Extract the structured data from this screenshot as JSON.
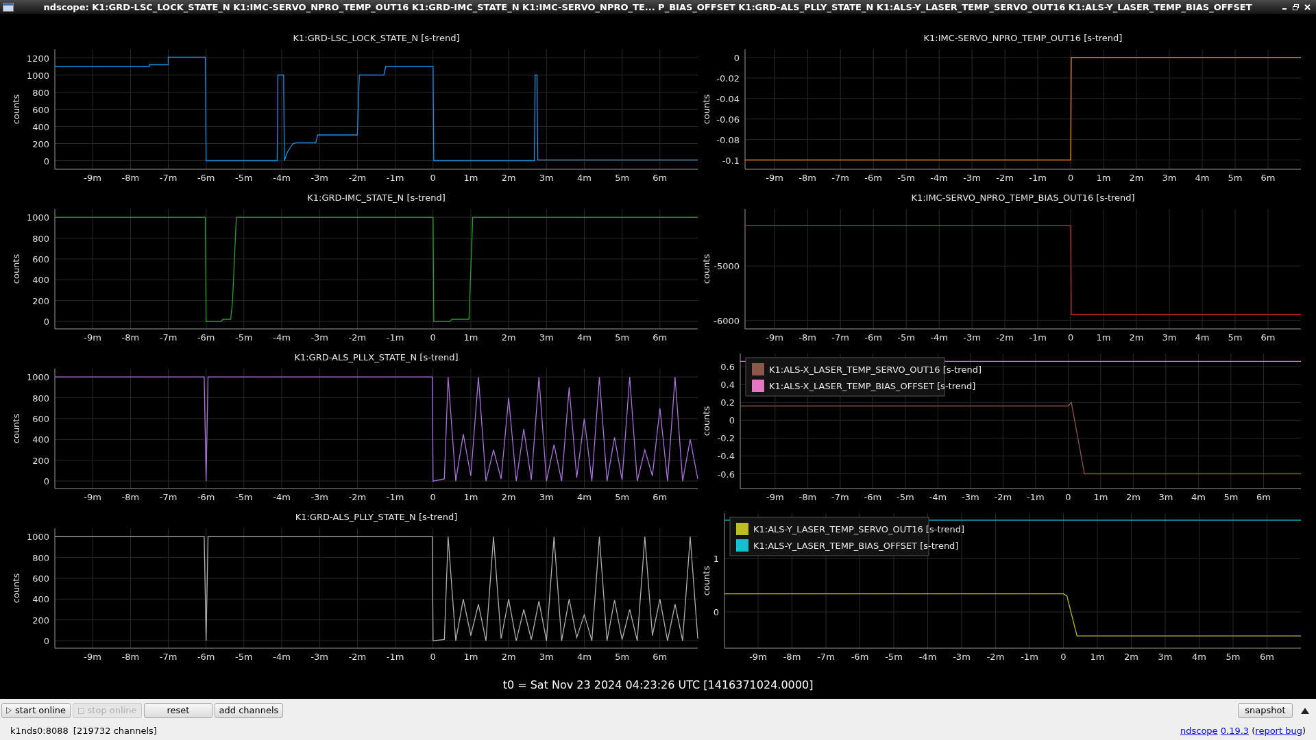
{
  "window": {
    "title": "ndscope: K1:GRD-LSC_LOCK_STATE_N K1:IMC-SERVO_NPRO_TEMP_OUT16 K1:GRD-IMC_STATE_N K1:IMC-SERVO_NPRO_TE... P_BIAS_OFFSET K1:GRD-ALS_PLLY_STATE_N K1:ALS-Y_LASER_TEMP_SERVO_OUT16 K1:ALS-Y_LASER_TEMP_BIAS_OFFSET"
  },
  "charts": [
    {
      "chart_data": {
        "type": "line",
        "grid": true,
        "title": "K1:GRD-LSC_LOCK_STATE_N [s-trend]",
        "ylabel": "counts",
        "xlim": [
          -10,
          7
        ],
        "ylim": [
          -100,
          1300
        ],
        "yticks": [
          0,
          200,
          400,
          600,
          800,
          1000,
          1200
        ],
        "xticks": [
          {
            "value": -9,
            "label": "-9m"
          },
          {
            "value": -8,
            "label": "-8m"
          },
          {
            "value": -7,
            "label": "-7m"
          },
          {
            "value": -6,
            "label": "-6m"
          },
          {
            "value": -5,
            "label": "-5m"
          },
          {
            "value": -4,
            "label": "-4m"
          },
          {
            "value": -3,
            "label": "-3m"
          },
          {
            "value": -2,
            "label": "-2m"
          },
          {
            "value": -1,
            "label": "-1m"
          },
          {
            "value": 0,
            "label": "0"
          },
          {
            "value": 1,
            "label": "1m"
          },
          {
            "value": 2,
            "label": "2m"
          },
          {
            "value": 3,
            "label": "3m"
          },
          {
            "value": 4,
            "label": "4m"
          },
          {
            "value": 5,
            "label": "5m"
          },
          {
            "value": 6,
            "label": "6m"
          }
        ],
        "x": [
          -10,
          -7.5,
          -7.5,
          -7,
          -7,
          -6.02,
          -6,
          -4.12,
          -4.1,
          -3.95,
          -3.93,
          -3.85,
          -3.7,
          -3.6,
          -3.1,
          -3.05,
          -2.0,
          -1.95,
          -1.3,
          -1.25,
          0,
          0.02,
          2.68,
          2.7,
          2.75,
          2.77,
          7
        ],
        "series": [
          {
            "color": "#1f8fe0",
            "values": [
              1100,
              1100,
              1120,
              1120,
              1210,
              1210,
              0,
              0,
              1000,
              1000,
              0,
              100,
              200,
              210,
              210,
              300,
              300,
              1000,
              1000,
              1100,
              1100,
              0,
              0,
              1000,
              1000,
              10,
              10
            ]
          }
        ]
      }
    },
    {
      "chart_data": {
        "type": "line",
        "grid": true,
        "title": "K1:IMC-SERVO_NPRO_TEMP_OUT16 [s-trend]",
        "ylabel": "counts",
        "xlim": [
          -9.9,
          7
        ],
        "ylim": [
          -0.109,
          0.008
        ],
        "yticks": [
          -0.1,
          -0.08,
          -0.06,
          -0.04,
          -0.02,
          0
        ],
        "xticks": [
          {
            "value": -9,
            "label": "-9m"
          },
          {
            "value": -8,
            "label": "-8m"
          },
          {
            "value": -7,
            "label": "-7m"
          },
          {
            "value": -6,
            "label": "-6m"
          },
          {
            "value": -5,
            "label": "-5m"
          },
          {
            "value": -4,
            "label": "-4m"
          },
          {
            "value": -3,
            "label": "-3m"
          },
          {
            "value": -2,
            "label": "-2m"
          },
          {
            "value": -1,
            "label": "-1m"
          },
          {
            "value": 0,
            "label": "0"
          },
          {
            "value": 1,
            "label": "1m"
          },
          {
            "value": 2,
            "label": "2m"
          },
          {
            "value": 3,
            "label": "3m"
          },
          {
            "value": 4,
            "label": "4m"
          },
          {
            "value": 5,
            "label": "5m"
          },
          {
            "value": 6,
            "label": "6m"
          }
        ],
        "x": [
          -9.9,
          0,
          0.02,
          7
        ],
        "series": [
          {
            "color": "#ff7f0e",
            "values": [
              -0.1,
              -0.1,
              0,
              0
            ]
          }
        ]
      }
    },
    {
      "chart_data": {
        "type": "line",
        "grid": true,
        "title": "K1:GRD-IMC_STATE_N [s-trend]",
        "ylabel": "counts",
        "xlim": [
          -10,
          7
        ],
        "ylim": [
          -72,
          1080
        ],
        "yticks": [
          0,
          200,
          400,
          600,
          800,
          1000
        ],
        "xticks": [
          {
            "value": -9,
            "label": "-9m"
          },
          {
            "value": -8,
            "label": "-8m"
          },
          {
            "value": -7,
            "label": "-7m"
          },
          {
            "value": -6,
            "label": "-6m"
          },
          {
            "value": -5,
            "label": "-5m"
          },
          {
            "value": -4,
            "label": "-4m"
          },
          {
            "value": -3,
            "label": "-3m"
          },
          {
            "value": -2,
            "label": "-2m"
          },
          {
            "value": -1,
            "label": "-1m"
          },
          {
            "value": 0,
            "label": "0"
          },
          {
            "value": 1,
            "label": "1m"
          },
          {
            "value": 2,
            "label": "2m"
          },
          {
            "value": 3,
            "label": "3m"
          },
          {
            "value": 4,
            "label": "4m"
          },
          {
            "value": 5,
            "label": "5m"
          },
          {
            "value": 6,
            "label": "6m"
          }
        ],
        "x": [
          -10,
          -6.02,
          -6,
          -5.6,
          -5.55,
          -5.35,
          -5.3,
          -5.2,
          0,
          0.02,
          0.45,
          0.5,
          0.95,
          1.05,
          7
        ],
        "series": [
          {
            "color": "#2ca02c",
            "values": [
              1000,
              1000,
              0,
              0,
              20,
              20,
              200,
              1000,
              1000,
              0,
              0,
              20,
              20,
              1000,
              1000
            ]
          }
        ]
      }
    },
    {
      "chart_data": {
        "type": "line",
        "grid": true,
        "title": "K1:IMC-SERVO_NPRO_TEMP_BIAS_OUT16 [s-trend]",
        "ylabel": "counts",
        "xlim": [
          -9.9,
          7
        ],
        "ylim": [
          -6154,
          -3954
        ],
        "yticks": [
          -6000,
          -5000
        ],
        "xticks": [
          {
            "value": -9,
            "label": "-9m"
          },
          {
            "value": -8,
            "label": "-8m"
          },
          {
            "value": -7,
            "label": "-7m"
          },
          {
            "value": -6,
            "label": "-6m"
          },
          {
            "value": -5,
            "label": "-5m"
          },
          {
            "value": -4,
            "label": "-4m"
          },
          {
            "value": -3,
            "label": "-3m"
          },
          {
            "value": -2,
            "label": "-2m"
          },
          {
            "value": -1,
            "label": "-1m"
          },
          {
            "value": 0,
            "label": "0"
          },
          {
            "value": 1,
            "label": "1m"
          },
          {
            "value": 2,
            "label": "2m"
          },
          {
            "value": 3,
            "label": "3m"
          },
          {
            "value": 4,
            "label": "4m"
          },
          {
            "value": 5,
            "label": "5m"
          },
          {
            "value": 6,
            "label": "6m"
          }
        ],
        "x": [
          -9.9,
          0,
          0.02,
          7
        ],
        "series": [
          {
            "color": "#d62728",
            "values": [
              -4260,
              -4260,
              -5890,
              -5890
            ]
          }
        ]
      }
    },
    {
      "chart_data": {
        "type": "line",
        "grid": true,
        "title": "K1:GRD-ALS_PLLX_STATE_N [s-trend]",
        "ylabel": "counts",
        "xlim": [
          -10,
          7
        ],
        "ylim": [
          -72,
          1080
        ],
        "yticks": [
          0,
          200,
          400,
          600,
          800,
          1000
        ],
        "xticks": [
          {
            "value": -9,
            "label": "-9m"
          },
          {
            "value": -8,
            "label": "-8m"
          },
          {
            "value": -7,
            "label": "-7m"
          },
          {
            "value": -6,
            "label": "-6m"
          },
          {
            "value": -5,
            "label": "-5m"
          },
          {
            "value": -4,
            "label": "-4m"
          },
          {
            "value": -3,
            "label": "-3m"
          },
          {
            "value": -2,
            "label": "-2m"
          },
          {
            "value": -1,
            "label": "-1m"
          },
          {
            "value": 0,
            "label": "0"
          },
          {
            "value": 1,
            "label": "1m"
          },
          {
            "value": 2,
            "label": "2m"
          },
          {
            "value": 3,
            "label": "3m"
          },
          {
            "value": 4,
            "label": "4m"
          },
          {
            "value": 5,
            "label": "5m"
          },
          {
            "value": 6,
            "label": "6m"
          }
        ],
        "x": [
          -10,
          -6.05,
          -6.0,
          -5.95,
          -0.02,
          0,
          0.3,
          0.4,
          0.6,
          0.8,
          1.0,
          1.2,
          1.4,
          1.6,
          1.8,
          2.0,
          2.2,
          2.4,
          2.6,
          2.8,
          3.0,
          3.2,
          3.4,
          3.6,
          3.8,
          4.0,
          4.2,
          4.4,
          4.6,
          4.8,
          5.0,
          5.2,
          5.4,
          5.6,
          5.8,
          6.0,
          6.2,
          6.4,
          6.6,
          6.8,
          7.0
        ],
        "series": [
          {
            "color": "#a874d8",
            "values": [
              1000,
              1000,
              0,
              1000,
              1000,
              0,
              20,
              1000,
              0,
              450,
              50,
              1000,
              0,
              300,
              20,
              800,
              0,
              500,
              10,
              1000,
              0,
              350,
              0,
              900,
              30,
              600,
              0,
              1000,
              0,
              420,
              10,
              1000,
              0,
              300,
              50,
              700,
              0,
              1000,
              0,
              400,
              20
            ]
          }
        ]
      }
    },
    {
      "chart_data": {
        "type": "line",
        "grid": true,
        "legend": true,
        "ylabel": "counts",
        "xlim": [
          -10.07,
          7.15
        ],
        "ylim": [
          -0.765,
          0.747
        ],
        "yticks": [
          -0.6,
          -0.4,
          -0.2,
          0,
          0.2,
          0.4,
          0.6
        ],
        "xticks": [
          {
            "value": -9,
            "label": "-9m"
          },
          {
            "value": -8,
            "label": "-8m"
          },
          {
            "value": -7,
            "label": "-7m"
          },
          {
            "value": -6,
            "label": "-6m"
          },
          {
            "value": -5,
            "label": "-5m"
          },
          {
            "value": -4,
            "label": "-4m"
          },
          {
            "value": -3,
            "label": "-3m"
          },
          {
            "value": -2,
            "label": "-2m"
          },
          {
            "value": -1,
            "label": "-1m"
          },
          {
            "value": 0,
            "label": "0"
          },
          {
            "value": 1,
            "label": "1m"
          },
          {
            "value": 2,
            "label": "2m"
          },
          {
            "value": 3,
            "label": "3m"
          },
          {
            "value": 4,
            "label": "4m"
          },
          {
            "value": 5,
            "label": "5m"
          },
          {
            "value": 6,
            "label": "6m"
          }
        ],
        "x": [
          -10.07,
          0,
          0.1,
          0.3,
          0.5,
          7.15
        ],
        "series": [
          {
            "name": "K1:ALS-X_LASER_TEMP_SERVO_OUT16 [s-trend]",
            "color": "#8c564b",
            "values": [
              0.16,
              0.16,
              0.2,
              -0.2,
              -0.6,
              -0.6
            ]
          },
          {
            "name": "K1:ALS-X_LASER_TEMP_BIAS_OFFSET [s-trend]",
            "color": "#e377c2",
            "values": [
              0.66,
              0.66,
              0.66,
              0.66,
              0.66,
              0.66
            ]
          }
        ]
      }
    },
    {
      "chart_data": {
        "type": "line",
        "grid": true,
        "title": "K1:GRD-ALS_PLLY_STATE_N [s-trend]",
        "ylabel": "counts",
        "xlim": [
          -10,
          7
        ],
        "ylim": [
          -72,
          1080
        ],
        "yticks": [
          0,
          200,
          400,
          600,
          800,
          1000
        ],
        "xticks": [
          {
            "value": -9,
            "label": "-9m"
          },
          {
            "value": -8,
            "label": "-8m"
          },
          {
            "value": -7,
            "label": "-7m"
          },
          {
            "value": -6,
            "label": "-6m"
          },
          {
            "value": -5,
            "label": "-5m"
          },
          {
            "value": -4,
            "label": "-4m"
          },
          {
            "value": -3,
            "label": "-3m"
          },
          {
            "value": -2,
            "label": "-2m"
          },
          {
            "value": -1,
            "label": "-1m"
          },
          {
            "value": 0,
            "label": "0"
          },
          {
            "value": 1,
            "label": "1m"
          },
          {
            "value": 2,
            "label": "2m"
          },
          {
            "value": 3,
            "label": "3m"
          },
          {
            "value": 4,
            "label": "4m"
          },
          {
            "value": 5,
            "label": "5m"
          },
          {
            "value": 6,
            "label": "6m"
          }
        ],
        "x": [
          -10,
          -6.05,
          -6.0,
          -5.95,
          -0.02,
          0,
          0.3,
          0.4,
          0.6,
          0.8,
          1.0,
          1.2,
          1.4,
          1.6,
          1.8,
          2.0,
          2.2,
          2.4,
          2.6,
          2.8,
          3.0,
          3.2,
          3.4,
          3.6,
          3.8,
          4.0,
          4.2,
          4.4,
          4.6,
          4.8,
          5.0,
          5.2,
          5.4,
          5.6,
          5.8,
          6.0,
          6.2,
          6.4,
          6.6,
          6.8,
          7.0
        ],
        "series": [
          {
            "color": "#b0b0b0",
            "values": [
              1000,
              1000,
              0,
              1000,
              1000,
              0,
              10,
              1000,
              0,
              400,
              50,
              350,
              0,
              1000,
              20,
              400,
              0,
              300,
              10,
              380,
              0,
              1000,
              0,
              400,
              30,
              250,
              0,
              1000,
              0,
              390,
              10,
              300,
              0,
              1000,
              50,
              400,
              0,
              350,
              0,
              1000,
              20
            ]
          }
        ]
      }
    },
    {
      "chart_data": {
        "type": "line",
        "grid": true,
        "legend": true,
        "ylabel": "counts",
        "xlim": [
          -9.99,
          7
        ],
        "ylim": [
          -0.68,
          1.85
        ],
        "yticks": [
          0,
          1
        ],
        "xticks": [
          {
            "value": -9,
            "label": "-9m"
          },
          {
            "value": -8,
            "label": "-8m"
          },
          {
            "value": -7,
            "label": "-7m"
          },
          {
            "value": -6,
            "label": "-6m"
          },
          {
            "value": -5,
            "label": "-5m"
          },
          {
            "value": -4,
            "label": "-4m"
          },
          {
            "value": -3,
            "label": "-3m"
          },
          {
            "value": -2,
            "label": "-2m"
          },
          {
            "value": -1,
            "label": "-1m"
          },
          {
            "value": 0,
            "label": "0"
          },
          {
            "value": 1,
            "label": "1m"
          },
          {
            "value": 2,
            "label": "2m"
          },
          {
            "value": 3,
            "label": "3m"
          },
          {
            "value": 4,
            "label": "4m"
          },
          {
            "value": 5,
            "label": "5m"
          },
          {
            "value": 6,
            "label": "6m"
          }
        ],
        "x": [
          -9.99,
          0,
          0.1,
          0.4,
          7
        ],
        "series": [
          {
            "name": "K1:ALS-Y_LASER_TEMP_SERVO_OUT16 [s-trend]",
            "color": "#bcbd22",
            "values": [
              0.34,
              0.34,
              0.3,
              -0.45,
              -0.45
            ]
          },
          {
            "name": "K1:ALS-Y_LASER_TEMP_BIAS_OFFSET [s-trend]",
            "color": "#17becf",
            "values": [
              1.72,
              1.72,
              1.72,
              1.72,
              1.72
            ]
          }
        ]
      }
    }
  ],
  "t0": "t0 = Sat Nov 23 2024 04:23:26 UTC [1416371024.0000]",
  "toolbar": [
    {
      "label": "start online",
      "kind": "play",
      "disabled": false
    },
    {
      "label": "stop online",
      "kind": "stop",
      "disabled": true
    },
    {
      "label": "reset",
      "kind": "plain",
      "disabled": false
    },
    {
      "label": "add channels",
      "kind": "plain",
      "disabled": false
    }
  ],
  "snapshot": "snapshot",
  "status": {
    "server": "k1nds0:8088",
    "channels": "[219732 channels]"
  },
  "about": {
    "app": "ndscope",
    "version": "0.19.3",
    "open": "(",
    "report": "report bug",
    "close": ")"
  }
}
